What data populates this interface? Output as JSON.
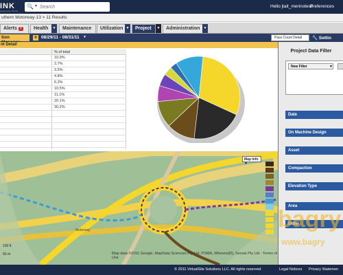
{
  "header": {
    "logo": "INK",
    "logo_sub": "powered by Trimble",
    "search_placeholder": "Search",
    "greeting": "Hello jtait_merinotest!",
    "preferences": "Preferences"
  },
  "breadcrumb": "uthern Motorway-13 > 11 Results",
  "tabs": [
    {
      "label": "Alerts",
      "badge": "7"
    },
    {
      "label": "Health"
    },
    {
      "label": "Maintenance"
    },
    {
      "label": "Utilization"
    },
    {
      "label": "Project",
      "active": true
    },
    {
      "label": "Administration"
    }
  ],
  "toolbar": {
    "active_tool": "tion Manager",
    "date_range": "08/29/11 - 08/31/11",
    "pass_count": "Pass Count Detail",
    "settings": "Settin"
  },
  "section_title": "nt Detail",
  "table": {
    "header": "% of total",
    "rows": [
      "10.9%",
      "2.7%",
      "3.5%",
      "4.8%",
      "6.2%",
      "10.5%",
      "11.1%",
      "20.1%",
      "30.2%",
      "",
      "",
      "",
      "",
      "",
      ""
    ]
  },
  "pie_colors": [
    "#f5d62a",
    "#2a2a2a",
    "#6b4d1c",
    "#7a7a22",
    "#b044b0",
    "#6b44b8",
    "#d4d838",
    "#2f6db0",
    "#35a7db"
  ],
  "pie_values": [
    30.2,
    20.1,
    11.1,
    10.5,
    6.2,
    4.8,
    3.5,
    2.7,
    10.9
  ],
  "map": {
    "map_info": "Map Info",
    "attribution": "Map data ©2011 Google, MapData Sciences Pty Ltd, PSMA, Whereis(R), Sensis Pty Ltd - Terms of Use",
    "road_label": "Motorway",
    "scale_ft": "100 ft",
    "scale_m": "50 m",
    "legend_colors": [
      "#3a2a12",
      "#5a3a18",
      "#806020",
      "#9a8a2a",
      "#7a3a9a",
      "#5a7ad0",
      "#3a9ae0",
      "#7ad0f0",
      "#f5d62a",
      "#f5d62a",
      "#f5d62a",
      "#f5d62a"
    ]
  },
  "right_panel": {
    "title": "Project Data Filter",
    "new_filter": "New Filter",
    "facets": [
      "Date",
      "On Machine Design",
      "Asset",
      "Compaction",
      "Elevation Type",
      "Area",
      "Other"
    ]
  },
  "footer": {
    "copyright": "© 2011 VirtualSite Solutions LLC. All rights reserved",
    "legal": "Legal Notices",
    "privacy": "Privacy Statemen"
  },
  "watermark": {
    "brand": "bagry",
    "url": "www.bagry"
  }
}
